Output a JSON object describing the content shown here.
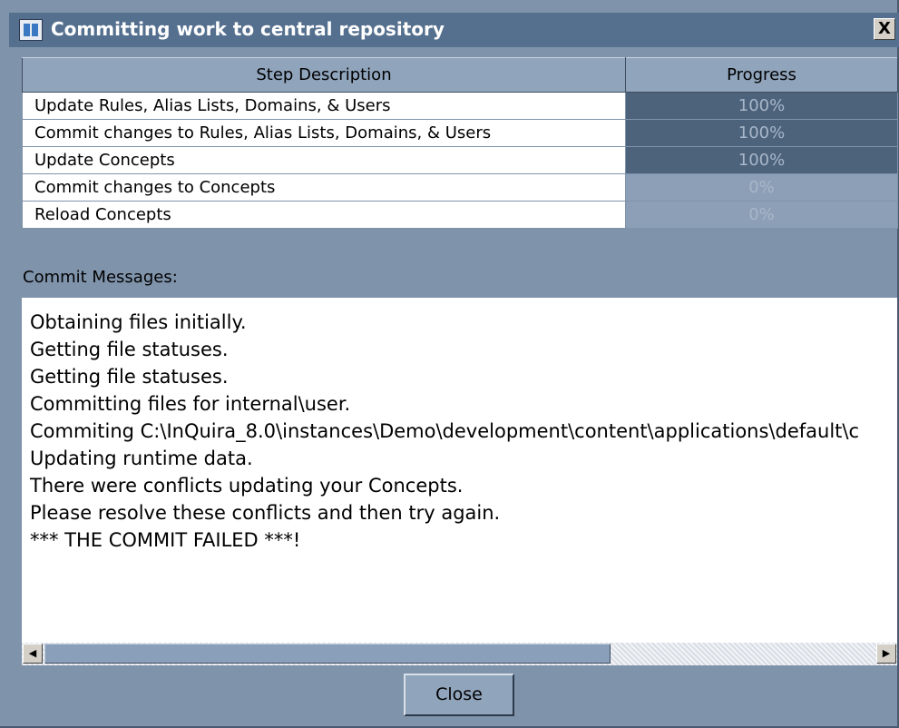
{
  "window": {
    "title": "Committing work to central repository",
    "close_glyph": "X"
  },
  "table": {
    "headers": [
      "Step Description",
      "Progress"
    ],
    "rows": [
      {
        "step": "Update Rules, Alias Lists, Domains, & Users",
        "progress": 100,
        "progress_label": "100%"
      },
      {
        "step": "Commit changes to Rules, Alias Lists, Domains, & Users",
        "progress": 100,
        "progress_label": "100%"
      },
      {
        "step": "Update Concepts",
        "progress": 100,
        "progress_label": "100%"
      },
      {
        "step": "Commit changes to Concepts",
        "progress": 0,
        "progress_label": "0%"
      },
      {
        "step": "Reload Concepts",
        "progress": 0,
        "progress_label": "0%"
      }
    ]
  },
  "messages": {
    "label": "Commit Messages:",
    "lines": [
      "Obtaining files initially.",
      "Getting file statuses.",
      "Getting file statuses.",
      "Committing files for internal\\user.",
      "Commiting C:\\InQuira_8.0\\instances\\Demo\\development\\content\\applications\\default\\c",
      "Updating runtime data.",
      "There were conflicts updating your Concepts.",
      "Please resolve these conflicts and then try again.",
      "*** THE COMMIT FAILED ***!"
    ]
  },
  "scrollbar": {
    "left_arrow_glyph": "◀",
    "right_arrow_glyph": "▶"
  },
  "buttons": {
    "close_label": "Close"
  },
  "icons": {
    "app": "repository-app-icon",
    "close": "close-icon"
  }
}
